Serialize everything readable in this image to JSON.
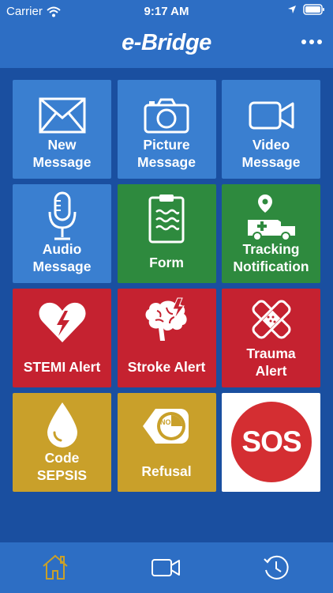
{
  "status_bar": {
    "carrier": "Carrier",
    "time": "9:17 AM"
  },
  "navbar": {
    "logo_text": "e-Bridge"
  },
  "tiles": [
    {
      "label": "New\nMessage",
      "color": "#3a7fd0",
      "icon": "envelope-icon"
    },
    {
      "label": "Picture\nMessage",
      "color": "#3a7fd0",
      "icon": "camera-icon"
    },
    {
      "label": "Video\nMessage",
      "color": "#3a7fd0",
      "icon": "video-camera-icon"
    },
    {
      "label": "Audio\nMessage",
      "color": "#3a7fd0",
      "icon": "microphone-icon"
    },
    {
      "label": "Form",
      "color": "#2e8a3e",
      "icon": "clipboard-icon"
    },
    {
      "label": "Tracking\nNotification",
      "color": "#2e8a3e",
      "icon": "ambulance-location-icon"
    },
    {
      "label": "STEMI Alert",
      "color": "#c52230",
      "icon": "heart-bolt-icon"
    },
    {
      "label": "Stroke Alert",
      "color": "#c52230",
      "icon": "brain-bolt-icon"
    },
    {
      "label": "Trauma\nAlert",
      "color": "#c52230",
      "icon": "crossed-bandage-icon"
    },
    {
      "label": "Code\nSEPSIS",
      "color": "#c9a02a",
      "icon": "droplet-icon"
    },
    {
      "label": "Refusal",
      "color": "#c9a02a",
      "icon": "no-tag-icon"
    },
    {
      "label": "SOS",
      "color": "#ffffff",
      "icon": "sos-icon"
    }
  ],
  "tab_bar": {
    "items": [
      "home-icon",
      "video-camera-icon",
      "history-icon"
    ],
    "active": "home-icon",
    "active_color": "#c9a02a"
  }
}
